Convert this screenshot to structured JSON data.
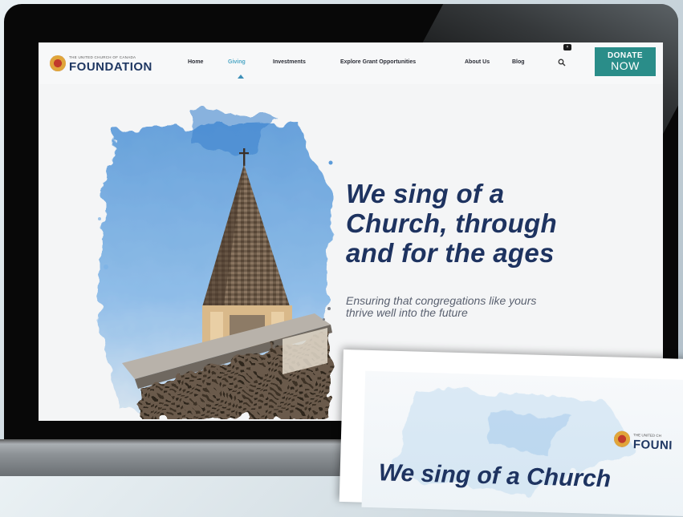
{
  "nav": {
    "logo_small": "The United Church of Canada",
    "logo_big": "FOUNDATION",
    "items": [
      {
        "label": "Home",
        "active": false
      },
      {
        "label": "Giving",
        "active": true
      },
      {
        "label": "Investments",
        "active": false
      },
      {
        "label": "Explore Grant Opportunities",
        "active": false
      },
      {
        "label": "About Us",
        "active": false
      },
      {
        "label": "Blog",
        "active": false
      }
    ],
    "search_icon": "search-icon",
    "close_chip": "×",
    "donate_line1": "DONATE",
    "donate_line2": "NOW"
  },
  "hero": {
    "title_lines": [
      "We sing of a",
      "Church, through",
      "and for the ages"
    ],
    "subtitle_lines": [
      "Ensuring that congregations like yours",
      "thrive well into the future"
    ]
  },
  "tablet": {
    "logo_small": "The United Ch",
    "logo_big": "FOUNI",
    "heading": "We sing of a Church"
  },
  "colors": {
    "accent": "#2a8d89",
    "brand_navy": "#1e3360",
    "active_nav": "#4fa8c6"
  }
}
